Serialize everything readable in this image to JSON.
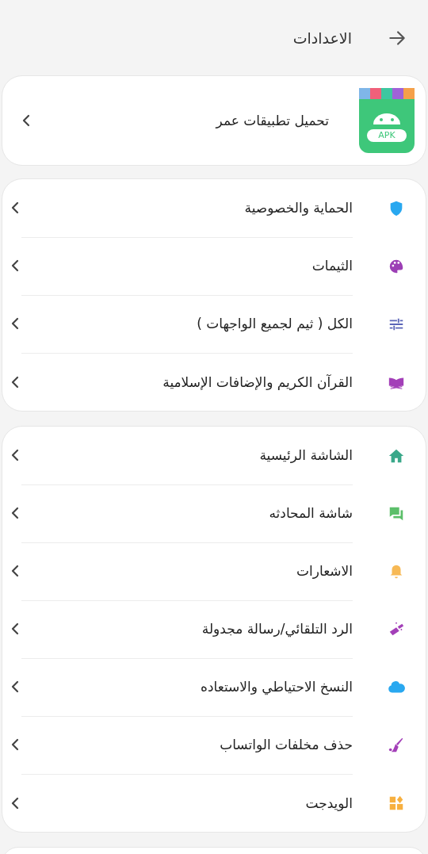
{
  "header": {
    "title": "الاعدادات"
  },
  "app_card": {
    "title": "تحميل تطبيقات عمر",
    "badge": "APK"
  },
  "groups": [
    {
      "items": [
        {
          "label": "الحماية والخصوصية",
          "kind": "shield",
          "color": "#29a8f0"
        },
        {
          "label": "الثيمات",
          "kind": "palette",
          "color": "#9c3fb5"
        },
        {
          "label": "الكل ( ثيم لجميع الواجهات )",
          "kind": "sliders",
          "color": "#5a64b8"
        },
        {
          "label": "القرآن الكريم والإضافات الإسلامية",
          "kind": "book",
          "color": "#a33fb8"
        }
      ]
    },
    {
      "items": [
        {
          "label": "الشاشة الرئيسية",
          "kind": "home",
          "color": "#3aa88a"
        },
        {
          "label": "شاشة المحادثه",
          "kind": "chat",
          "color": "#5cbf6a"
        },
        {
          "label": "الاشعارات",
          "kind": "bell",
          "color": "#f7b955"
        },
        {
          "label": "الرد التلقائي/رسالة مجدولة",
          "kind": "wand",
          "color": "#a33fb8"
        },
        {
          "label": "النسخ الاحتياطي والاستعاده",
          "kind": "cloud",
          "color": "#29a8f0"
        },
        {
          "label": "حذف مخلفات الواتساب",
          "kind": "broom",
          "color": "#a33fb8"
        },
        {
          "label": "الويدجت",
          "kind": "widgets",
          "color": "#f7b040"
        }
      ]
    }
  ]
}
